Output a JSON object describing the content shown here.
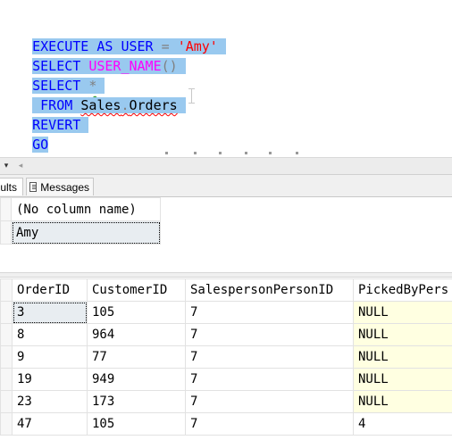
{
  "editor": {
    "lines": [
      {
        "tokens": [
          "EXECUTE AS USER",
          " = ",
          "'Amy'"
        ]
      },
      {
        "tokens": [
          "SELECT ",
          "USER_NAME",
          "()"
        ]
      },
      {
        "tokens": [
          "SELECT ",
          "*"
        ]
      },
      {
        "tokens": [
          " FROM ",
          "Sales",
          ".",
          "Orders"
        ]
      },
      {
        "tokens": [
          "REVERT"
        ]
      },
      {
        "tokens": [
          "GO"
        ]
      }
    ]
  },
  "editor_bar": {
    "zoom_dropdown_glyph": "▾",
    "scroll_left_glyph": "◂"
  },
  "result_tabs": {
    "results_label": "sults",
    "messages_label": "Messages"
  },
  "grid1": {
    "columns": [
      "(No column name)"
    ],
    "rows": [
      [
        "Amy"
      ]
    ]
  },
  "grid2": {
    "columns": [
      "OrderID",
      "CustomerID",
      "SalespersonPersonID",
      "PickedByPers"
    ],
    "rows": [
      [
        "3",
        "105",
        "7",
        "NULL"
      ],
      [
        "8",
        "964",
        "7",
        "NULL"
      ],
      [
        "9",
        "77",
        "7",
        "NULL"
      ],
      [
        "19",
        "949",
        "7",
        "NULL"
      ],
      [
        "23",
        "173",
        "7",
        "NULL"
      ],
      [
        "47",
        "105",
        "7",
        "4"
      ]
    ]
  },
  "colors": {
    "keyword": "#0000ff",
    "function": "#ff00ff",
    "string": "#ff0000",
    "selection": "#99c9ef",
    "null_cell_bg": "#ffffe1"
  }
}
